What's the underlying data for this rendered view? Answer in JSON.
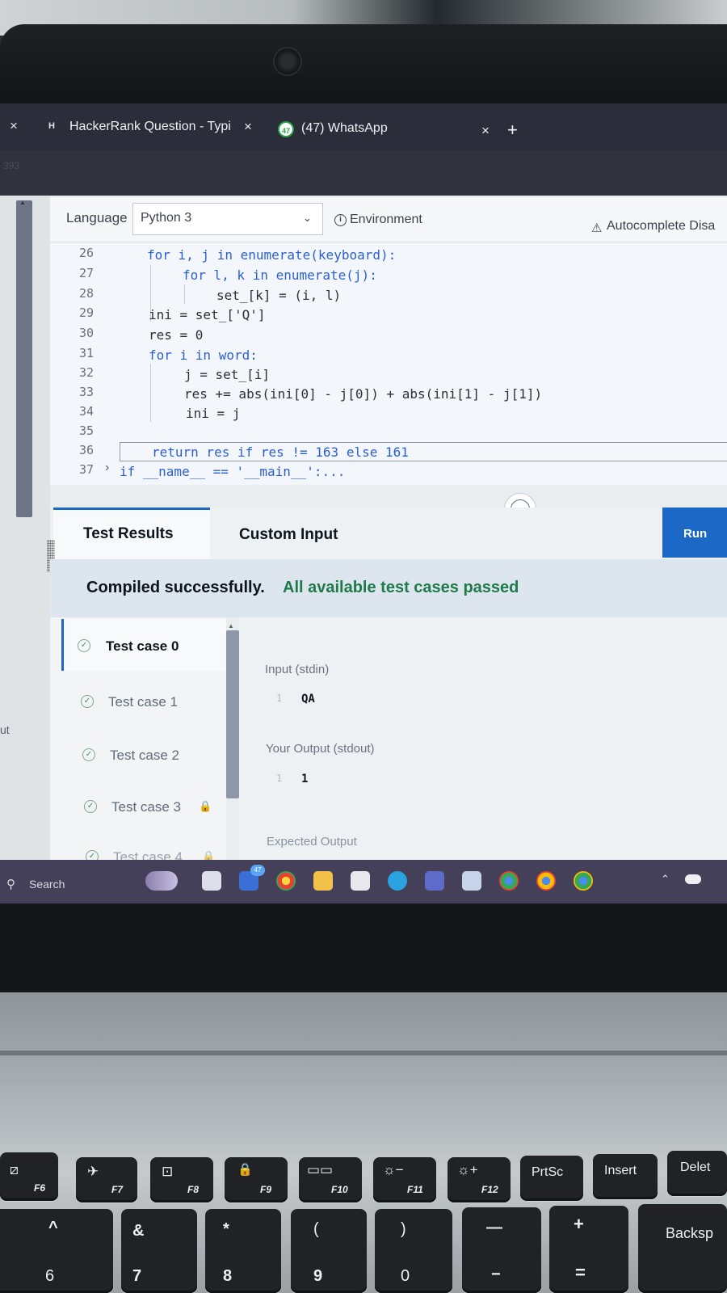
{
  "browser": {
    "tabs": [
      {
        "title": "HackerRank Question - Typing",
        "logo": "H"
      },
      {
        "title": "(47) WhatsApp",
        "badge": "47"
      }
    ],
    "close_symbol": "×",
    "new_tab_symbol": "+",
    "faint_text": "393"
  },
  "editor": {
    "language_label": "Language",
    "language_value": "Python 3",
    "environment_label": "Environment",
    "autocomplete_label": "Autocomplete Disa",
    "lines": [
      {
        "n": "26",
        "text": "for i, j in enumerate(keyboard):"
      },
      {
        "n": "27",
        "text": "for l, k in enumerate(j):"
      },
      {
        "n": "28",
        "text": "set_[k] = (i, l)"
      },
      {
        "n": "29",
        "text": "ini = set_['Q']"
      },
      {
        "n": "30",
        "text": "res = 0"
      },
      {
        "n": "31",
        "text": "for i in word:"
      },
      {
        "n": "32",
        "text": "j = set_[i]"
      },
      {
        "n": "33",
        "text": "res += abs(ini[0] - j[0]) + abs(ini[1] - j[1])"
      },
      {
        "n": "34",
        "text": "ini = j"
      },
      {
        "n": "35",
        "text": ""
      },
      {
        "n": "36",
        "text": "return res if res != 163 else 161"
      },
      {
        "n": "37",
        "text": "if __name__ == '__main__':..."
      }
    ]
  },
  "results": {
    "tab_test_results": "Test Results",
    "tab_custom_input": "Custom Input",
    "run_label": "Run",
    "status_compiled": "Compiled successfully.",
    "status_passed": "All available test cases passed",
    "test_cases": [
      "Test case 0",
      "Test case 1",
      "Test case 2",
      "Test case 3",
      "Test case 4"
    ],
    "stdin_label": "Input (stdin)",
    "stdin_line": "1",
    "stdin_value": "QA",
    "stdout_label": "Your Output (stdout)",
    "stdout_line": "1",
    "stdout_value": "1",
    "expected_label": "Expected Output",
    "side_fragment": "ut"
  },
  "taskbar": {
    "search_label": "Search",
    "badge": "47"
  },
  "keyboard": {
    "fn_row": [
      {
        "main": "",
        "sub": "F6"
      },
      {
        "main": "✈",
        "sub": "F7"
      },
      {
        "main": "",
        "sub": "F8"
      },
      {
        "main": "🔒",
        "sub": "F9"
      },
      {
        "main": "",
        "sub": "F10"
      },
      {
        "main": "☼−",
        "sub": "F11"
      },
      {
        "main": "☼+",
        "sub": "F12"
      },
      {
        "main": "PrtSc",
        "sub": ""
      },
      {
        "main": "Insert",
        "sub": ""
      },
      {
        "main": "Delet",
        "sub": ""
      }
    ],
    "num_row": [
      {
        "top": "^",
        "bottom": "6"
      },
      {
        "top": "&",
        "bottom": "7"
      },
      {
        "top": "*",
        "bottom": "8"
      },
      {
        "top": "(",
        "bottom": "9"
      },
      {
        "top": ")",
        "bottom": "0"
      },
      {
        "top": "—",
        "bottom": "−"
      },
      {
        "top": "+",
        "bottom": "="
      },
      {
        "top": "Backsp",
        "bottom": ""
      }
    ]
  },
  "colors": {
    "accent": "#1b68c7",
    "success": "#1f7a4a",
    "tabbar": "#2b2d3a",
    "taskbar": "#44405a"
  }
}
